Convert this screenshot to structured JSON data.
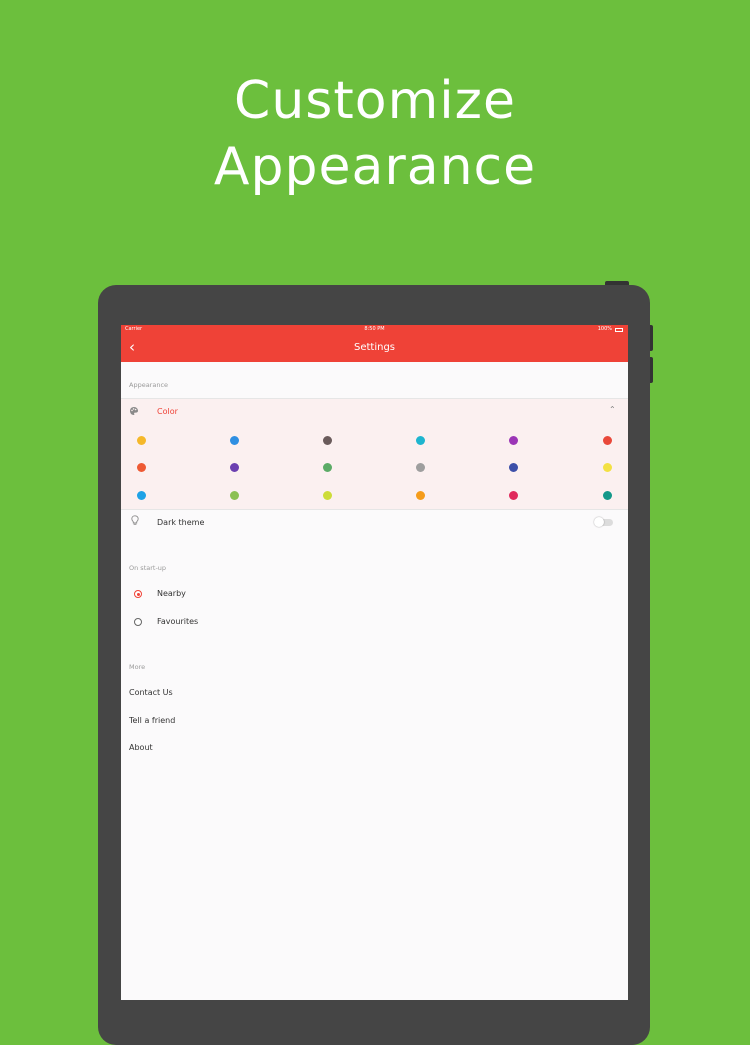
{
  "headline": {
    "line1": "Customize",
    "line2": "Appearance"
  },
  "status_bar": {
    "carrier": "Carrier",
    "time": "8:50 PM",
    "battery": "100%"
  },
  "nav": {
    "title": "Settings",
    "back_icon": "chevron-left-icon"
  },
  "appearance": {
    "section_label": "Appearance",
    "color_label": "Color",
    "color_icon": "palette-icon",
    "expanded_icon": "chevron-up-icon",
    "colors": [
      "#f5b82a",
      "#2f8fe2",
      "#6a5b5b",
      "#1eb5cf",
      "#9b35b6",
      "#e9483a",
      "#ee5a34",
      "#6b3fb0",
      "#5bab66",
      "#9e9e9e",
      "#3c4fa8",
      "#f3e143",
      "#1ea2e6",
      "#8cc053",
      "#cddc39",
      "#f59c1a",
      "#e02a5c",
      "#14988a"
    ],
    "dark_theme_label": "Dark theme",
    "dark_theme_icon": "lightbulb-icon",
    "dark_theme_on": false
  },
  "startup": {
    "section_label": "On start-up",
    "options": [
      {
        "label": "Nearby",
        "selected": true
      },
      {
        "label": "Favourites",
        "selected": false
      }
    ]
  },
  "more": {
    "section_label": "More",
    "items": [
      "Contact Us",
      "Tell a friend",
      "About"
    ]
  },
  "theme": {
    "accent": "#ef4237",
    "background": "#6cbf3d",
    "device": "#454545"
  }
}
